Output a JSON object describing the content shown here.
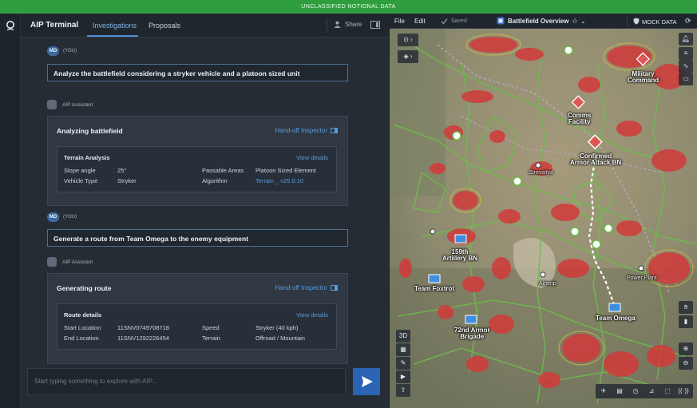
{
  "banner": "UNCLASSIFIED NOTIONAL DATA",
  "header": {
    "app_title": "AIP Terminal",
    "tabs": [
      "Investigations",
      "Proposals"
    ],
    "share_label": "Share"
  },
  "messages": [
    {
      "user_initials": "MD",
      "user_tag": "(YOU)",
      "text": "Analyze the battlefield considering a stryker vehicle and a platoon sized unit",
      "assistant_name": "AIP Assistant",
      "card_title": "Analyzing battlefield",
      "handoff": "Hand-off Inspector",
      "section_title": "Terrain Analysis",
      "view_details": "View details",
      "rows": [
        [
          "Slope angle",
          "25°",
          "Passable Areas",
          "Platoon Sized Element"
        ],
        [
          "Vehicle Type",
          "Stryker",
          "Algorithm",
          "Terrain _ v25.0.10"
        ]
      ]
    },
    {
      "user_initials": "MD",
      "user_tag": "(YOU)",
      "text": "Generate a route from Team Omega to the enemy equipment",
      "assistant_name": "AIP Assistant",
      "card_title": "Generating route",
      "handoff": "Hand-off Inspector",
      "section_title": "Route details",
      "view_details": "View details",
      "rows": [
        [
          "Start Location",
          "11SNV0749708718",
          "Speed",
          "Stryker (40 kph)"
        ],
        [
          "End Location",
          "11SNV1292226454",
          "Terrain",
          "Offroad / Mountain"
        ]
      ]
    }
  ],
  "input": {
    "placeholder": "Start typing something to explore with AIP..."
  },
  "map_header": {
    "file": "File",
    "edit": "Edit",
    "saved": "Saved",
    "title": "Battlefield Overview",
    "mock": "MOCK DATA"
  },
  "map_labels": {
    "military_command": [
      "Military",
      "Command"
    ],
    "comms_facility": [
      "Comms",
      "Facility"
    ],
    "confirmed_armor": [
      "Confirmed",
      "Armor Attack BN"
    ],
    "strevistya": "Strevistya",
    "artillery": [
      "159th",
      "Artillery BN"
    ],
    "team_foxtrot": "Team Foxtrot",
    "airstrip": "Airstrip",
    "power_plant": "Power Plant",
    "team_omega": "Team Omega",
    "armor_brigade": [
      "72nd Armor",
      "Brigade"
    ]
  },
  "map_tools": {
    "three_d": "3D"
  },
  "colors": {
    "banner": "#2f9e3f",
    "accent": "#4d90d9",
    "link": "#5b9ad9",
    "send_button": "#2a64b4",
    "enemy_marker": "#e05555",
    "friendly_marker": "#3d8fe0",
    "road": "#6bbf4a"
  }
}
